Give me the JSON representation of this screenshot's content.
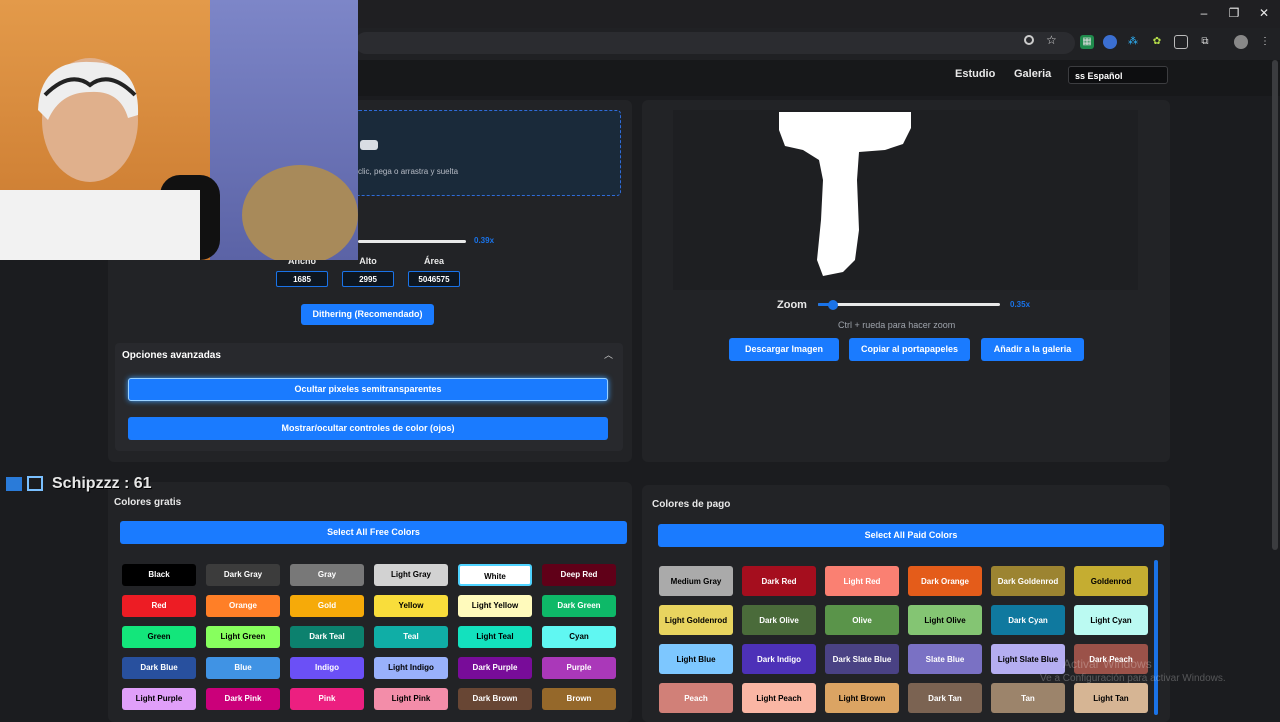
{
  "browser": {
    "window_controls": [
      "–",
      "❐",
      "✕"
    ]
  },
  "nav": {
    "studio": "Estudio",
    "gallery": "Galeria",
    "language": "Español",
    "language_flag": "ss"
  },
  "upload": {
    "text": "clic, pega o arrastra y suelta"
  },
  "scale": {
    "value": "0.39x",
    "level": 0.75
  },
  "dimensions": {
    "width_label": "Ancho",
    "height_label": "Alto",
    "area_label": "Área",
    "width": "1685",
    "height": "2995",
    "area": "5046575"
  },
  "dither_button": "Dithering (Recomendado)",
  "advanced": {
    "title": "Opciones avanzadas",
    "hide_transparent": "Ocultar pixeles semitransparentes",
    "toggle_eyes": "Mostrar/ocultar controles de color (ojos)"
  },
  "preview": {
    "zoom_label": "Zoom",
    "zoom_value": "0.35x",
    "zoom_level": 0.08,
    "hint": "Ctrl + rueda para hacer zoom",
    "download": "Descargar Imagen",
    "copy": "Copiar al portapapeles",
    "add_gallery": "Añadir a la galeria"
  },
  "stream_overlay": "Schipzzz : 61",
  "free_colors": {
    "title": "Colores gratis",
    "select_all": "Select All Free Colors",
    "colors": [
      {
        "name": "Black",
        "bg": "#000000",
        "fg": "#ffffff"
      },
      {
        "name": "Dark Gray",
        "bg": "#3c3c3c",
        "fg": "#ffffff"
      },
      {
        "name": "Gray",
        "bg": "#787878",
        "fg": "#ffffff"
      },
      {
        "name": "Light Gray",
        "bg": "#d2d2d2",
        "fg": "#000000"
      },
      {
        "name": "White",
        "bg": "#ffffff",
        "fg": "#000000"
      },
      {
        "name": "Deep Red",
        "bg": "#600018",
        "fg": "#ffffff"
      },
      {
        "name": "Red",
        "bg": "#ed1c24",
        "fg": "#ffffff"
      },
      {
        "name": "Orange",
        "bg": "#ff7f27",
        "fg": "#ffffff"
      },
      {
        "name": "Gold",
        "bg": "#f6aa09",
        "fg": "#ffffff"
      },
      {
        "name": "Yellow",
        "bg": "#f9dd3b",
        "fg": "#000000"
      },
      {
        "name": "Light Yellow",
        "bg": "#fffabc",
        "fg": "#000000"
      },
      {
        "name": "Dark Green",
        "bg": "#0eb968",
        "fg": "#ffffff"
      },
      {
        "name": "Green",
        "bg": "#13e67b",
        "fg": "#000000"
      },
      {
        "name": "Light Green",
        "bg": "#87ff5e",
        "fg": "#000000"
      },
      {
        "name": "Dark Teal",
        "bg": "#0c816e",
        "fg": "#ffffff"
      },
      {
        "name": "Teal",
        "bg": "#10aea6",
        "fg": "#ffffff"
      },
      {
        "name": "Light Teal",
        "bg": "#13e1be",
        "fg": "#000000"
      },
      {
        "name": "Cyan",
        "bg": "#60f7f2",
        "fg": "#000000"
      },
      {
        "name": "Dark Blue",
        "bg": "#28509e",
        "fg": "#ffffff"
      },
      {
        "name": "Blue",
        "bg": "#4093e4",
        "fg": "#ffffff"
      },
      {
        "name": "Indigo",
        "bg": "#6b50f6",
        "fg": "#ffffff"
      },
      {
        "name": "Light Indigo",
        "bg": "#99b1fb",
        "fg": "#000000"
      },
      {
        "name": "Dark Purple",
        "bg": "#780c99",
        "fg": "#ffffff"
      },
      {
        "name": "Purple",
        "bg": "#aa38b9",
        "fg": "#ffffff"
      },
      {
        "name": "Light Purple",
        "bg": "#e09ff9",
        "fg": "#000000"
      },
      {
        "name": "Dark Pink",
        "bg": "#cb007a",
        "fg": "#ffffff"
      },
      {
        "name": "Pink",
        "bg": "#ec1f80",
        "fg": "#ffffff"
      },
      {
        "name": "Light Pink",
        "bg": "#f38da9",
        "fg": "#000000"
      },
      {
        "name": "Dark Brown",
        "bg": "#684634",
        "fg": "#ffffff"
      },
      {
        "name": "Brown",
        "bg": "#95682a",
        "fg": "#ffffff"
      }
    ]
  },
  "paid_colors": {
    "title": "Colores de pago",
    "select_all": "Select All Paid Colors",
    "colors": [
      {
        "name": "Medium Gray",
        "bg": "#aaaaaa",
        "fg": "#000000"
      },
      {
        "name": "Dark Red",
        "bg": "#a50e1e",
        "fg": "#ffffff"
      },
      {
        "name": "Light Red",
        "bg": "#fa8072",
        "fg": "#ffffff"
      },
      {
        "name": "Dark Orange",
        "bg": "#e45c1a",
        "fg": "#ffffff"
      },
      {
        "name": "Dark Goldenrod",
        "bg": "#9c8431",
        "fg": "#ffffff"
      },
      {
        "name": "Goldenrod",
        "bg": "#c5ad31",
        "fg": "#000000"
      },
      {
        "name": "Light Goldenrod",
        "bg": "#e8d45f",
        "fg": "#000000"
      },
      {
        "name": "Dark Olive",
        "bg": "#4a6b3a",
        "fg": "#ffffff"
      },
      {
        "name": "Olive",
        "bg": "#5a944a",
        "fg": "#ffffff"
      },
      {
        "name": "Light Olive",
        "bg": "#84c573",
        "fg": "#000000"
      },
      {
        "name": "Dark Cyan",
        "bg": "#0f799f",
        "fg": "#ffffff"
      },
      {
        "name": "Light Cyan",
        "bg": "#bbfaf2",
        "fg": "#000000"
      },
      {
        "name": "Light Blue",
        "bg": "#7dc7ff",
        "fg": "#000000"
      },
      {
        "name": "Dark Indigo",
        "bg": "#4d31b8",
        "fg": "#ffffff"
      },
      {
        "name": "Dark Slate Blue",
        "bg": "#4a4284",
        "fg": "#ffffff"
      },
      {
        "name": "Slate Blue",
        "bg": "#7a71c4",
        "fg": "#ffffff"
      },
      {
        "name": "Light Slate Blue",
        "bg": "#b5aef1",
        "fg": "#000000"
      },
      {
        "name": "Dark Peach",
        "bg": "#9b5249",
        "fg": "#ffffff"
      },
      {
        "name": "Peach",
        "bg": "#d18078",
        "fg": "#ffffff"
      },
      {
        "name": "Light Peach",
        "bg": "#fab6a4",
        "fg": "#000000"
      },
      {
        "name": "Light Brown",
        "bg": "#dba463",
        "fg": "#000000"
      },
      {
        "name": "Dark Tan",
        "bg": "#7b6352",
        "fg": "#ffffff"
      },
      {
        "name": "Tan",
        "bg": "#9c846b",
        "fg": "#ffffff"
      },
      {
        "name": "Light Tan",
        "bg": "#d6b594",
        "fg": "#000000"
      }
    ]
  },
  "watermark": {
    "line1": "Activar Windows",
    "line2": "Ve a Configuración para activar Windows."
  },
  "colors": {
    "accent": "#1a7bff",
    "page_bg": "#1b1c1f",
    "panel_bg": "#222326"
  }
}
